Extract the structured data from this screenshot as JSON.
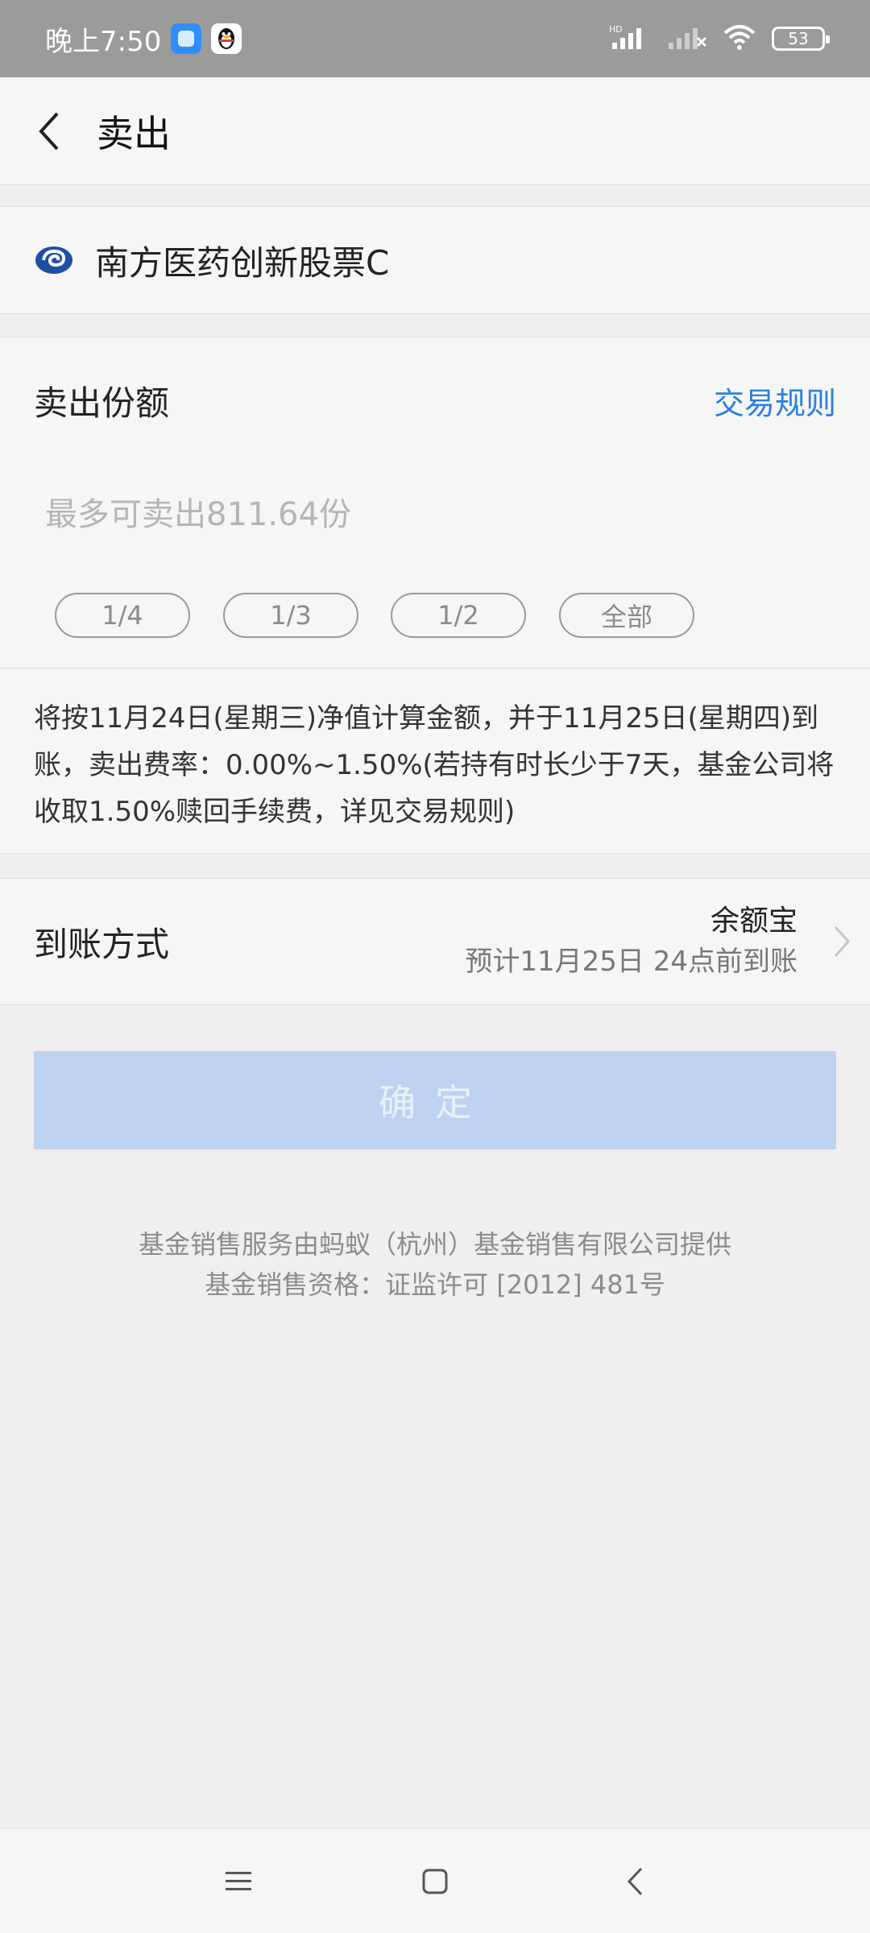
{
  "status_bar": {
    "time": "晚上7:50",
    "battery": "53",
    "network_label": "HD"
  },
  "nav": {
    "title": "卖出"
  },
  "fund": {
    "name": "南方医药创新股票C"
  },
  "sell": {
    "label": "卖出份额",
    "rules_link": "交易规则",
    "placeholder": "最多可卖出811.64份",
    "fractions": [
      "1/4",
      "1/3",
      "1/2",
      "全部"
    ]
  },
  "notice": {
    "text": "将按11月24日(星期三)净值计算金额，并于11月25日(星期四)到账，卖出费率：0.00%~1.50%(若持有时长少于7天，基金公司将收取1.50%赎回手续费，详见交易规则)"
  },
  "arrival": {
    "label": "到账方式",
    "method": "余额宝",
    "time": "预计11月25日 24点前到账"
  },
  "confirm": {
    "label": "确定"
  },
  "footer": {
    "line1": "基金销售服务由蚂蚁（杭州）基金销售有限公司提供",
    "line2": "基金销售资格：证监许可 [2012] 481号"
  },
  "icons": {
    "back": "back-arrow-icon",
    "fund_logo": "fund-company-logo-icon",
    "chevron": "chevron-right-icon"
  },
  "colors": {
    "accent": "#2a7ee3",
    "confirm_disabled": "#bed3f1"
  }
}
